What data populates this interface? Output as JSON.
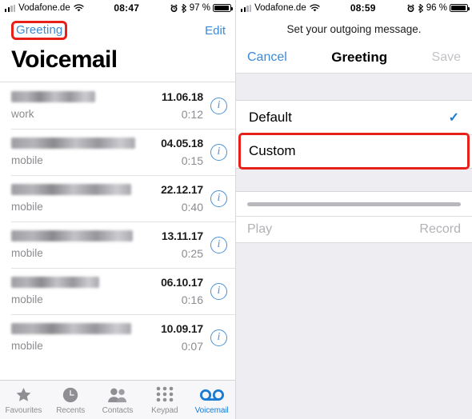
{
  "left": {
    "status": {
      "carrier": "Vodafone.de",
      "time": "08:47",
      "battery_pct": "97 %",
      "signal_icon": "signal-bars-icon",
      "wifi_icon": "wifi-icon",
      "alarm_icon": "alarm-clock-icon",
      "bluetooth_icon": "bluetooth-icon",
      "battery_icon": "battery-icon"
    },
    "nav": {
      "greeting_label": "Greeting",
      "edit_label": "Edit",
      "highlight_color": "#e8201a"
    },
    "page_title": "Voicemail",
    "rows": [
      {
        "name": "",
        "type": "work",
        "date": "11.06.18",
        "duration": "0:12",
        "info_label": "i"
      },
      {
        "name": "",
        "type": "mobile",
        "date": "04.05.18",
        "duration": "0:15",
        "info_label": "i"
      },
      {
        "name": "",
        "type": "mobile",
        "date": "22.12.17",
        "duration": "0:40",
        "info_label": "i"
      },
      {
        "name": "",
        "type": "mobile",
        "date": "13.11.17",
        "duration": "0:25",
        "info_label": "i"
      },
      {
        "name": "",
        "type": "mobile",
        "date": "06.10.17",
        "duration": "0:16",
        "info_label": "i"
      },
      {
        "name": "",
        "type": "mobile",
        "date": "10.09.17",
        "duration": "0:07",
        "info_label": "i"
      }
    ],
    "tabs": [
      {
        "label": "Favourites",
        "icon": "star-icon",
        "active": false
      },
      {
        "label": "Recents",
        "icon": "clock-icon",
        "active": false
      },
      {
        "label": "Contacts",
        "icon": "contacts-icon",
        "active": false
      },
      {
        "label": "Keypad",
        "icon": "keypad-icon",
        "active": false
      },
      {
        "label": "Voicemail",
        "icon": "voicemail-icon",
        "active": true
      }
    ],
    "accent_color": "#1a7bd4"
  },
  "right": {
    "status": {
      "carrier": "Vodafone.de",
      "time": "08:59",
      "battery_pct": "96 %"
    },
    "subtitle": "Set your outgoing message.",
    "nav": {
      "cancel_label": "Cancel",
      "title": "Greeting",
      "save_label": "Save"
    },
    "options": [
      {
        "label": "Default",
        "selected": true,
        "check_glyph": "✓",
        "highlighted": false
      },
      {
        "label": "Custom",
        "selected": false,
        "check_glyph": "",
        "highlighted": true
      }
    ],
    "controls": {
      "play_label": "Play",
      "record_label": "Record"
    },
    "highlight_color": "#e8201a"
  }
}
